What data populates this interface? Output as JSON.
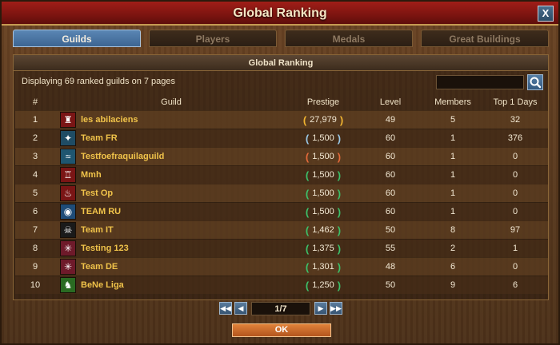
{
  "window": {
    "title": "Global Ranking",
    "close_label": "X"
  },
  "tabs": [
    {
      "label": "Guilds",
      "active": true
    },
    {
      "label": "Players",
      "active": false
    },
    {
      "label": "Medals",
      "active": false
    },
    {
      "label": "Great Buildings",
      "active": false
    }
  ],
  "panel": {
    "header": "Global Ranking",
    "info": "Displaying 69 ranked guilds on 7 pages",
    "search": {
      "value": "",
      "placeholder": ""
    }
  },
  "table": {
    "columns": [
      "#",
      "Guild",
      "Prestige",
      "Level",
      "Members",
      "Top 1 Days"
    ],
    "rows": [
      {
        "rank": "1",
        "emblem": "tower-emblem-icon",
        "emblem_color": "#7a1515",
        "moon_color": "#f0b431",
        "name": "les abilaciens",
        "prestige": "27,979",
        "level": "49",
        "members": "5",
        "top_days": "32"
      },
      {
        "rank": "2",
        "emblem": "bird-emblem-icon",
        "emblem_color": "#1f4c64",
        "moon_color": "#9ac8e6",
        "name": "Team FR",
        "prestige": "1,500",
        "level": "60",
        "members": "1",
        "top_days": "376"
      },
      {
        "rank": "3",
        "emblem": "wave-emblem-icon",
        "emblem_color": "#1f5670",
        "moon_color": "#e46a3a",
        "name": "Testfoefraquilaguild",
        "prestige": "1,500",
        "level": "60",
        "members": "1",
        "top_days": "0"
      },
      {
        "rank": "4",
        "emblem": "castle-emblem-icon",
        "emblem_color": "#7a1515",
        "moon_color": "#3cc16a",
        "name": "Mmh",
        "prestige": "1,500",
        "level": "60",
        "members": "1",
        "top_days": "0"
      },
      {
        "rank": "5",
        "emblem": "flame-emblem-icon",
        "emblem_color": "#7a1515",
        "moon_color": "#3cc16a",
        "name": "Test Op",
        "prestige": "1,500",
        "level": "60",
        "members": "1",
        "top_days": "0"
      },
      {
        "rank": "6",
        "emblem": "eye-emblem-icon",
        "emblem_color": "#1f4c78",
        "moon_color": "#3cc16a",
        "name": "TEAM RU",
        "prestige": "1,500",
        "level": "60",
        "members": "1",
        "top_days": "0"
      },
      {
        "rank": "7",
        "emblem": "skull-emblem-icon",
        "emblem_color": "#1a1a1a",
        "moon_color": "#3cc16a",
        "name": "Team IT",
        "prestige": "1,462",
        "level": "50",
        "members": "8",
        "top_days": "97"
      },
      {
        "rank": "8",
        "emblem": "star-emblem-icon",
        "emblem_color": "#6e1a2a",
        "moon_color": "#3cc16a",
        "name": "Testing 123",
        "prestige": "1,375",
        "level": "55",
        "members": "2",
        "top_days": "1"
      },
      {
        "rank": "9",
        "emblem": "star-emblem-icon",
        "emblem_color": "#6e1a2a",
        "moon_color": "#3cc16a",
        "name": "Team DE",
        "prestige": "1,301",
        "level": "48",
        "members": "6",
        "top_days": "0"
      },
      {
        "rank": "10",
        "emblem": "lion-emblem-icon",
        "emblem_color": "#2a6a22",
        "moon_color": "#3cc16a",
        "name": "BeNe Liga",
        "prestige": "1,250",
        "level": "50",
        "members": "9",
        "top_days": "6"
      }
    ]
  },
  "pager": {
    "page": "1/7"
  },
  "footer": {
    "ok_label": "OK"
  }
}
